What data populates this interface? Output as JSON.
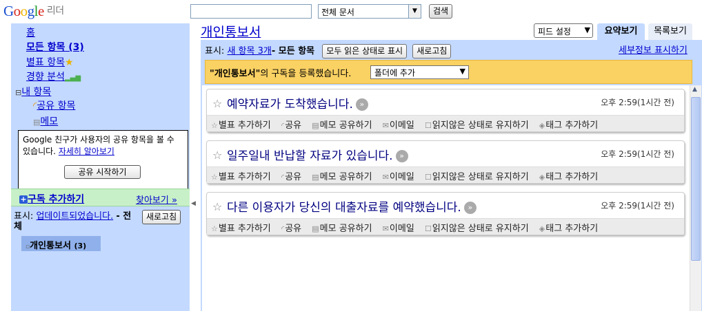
{
  "header": {
    "logo_sub": "리더",
    "search_placeholder": "",
    "scope": "전체 문서",
    "search_button": "검색"
  },
  "sidebar": {
    "home": "홈",
    "all_items": "모든 항목 (3)",
    "starred": "별표 항목",
    "trends": "경향 분석",
    "my_items": "내 항목",
    "shared": "공유 항목",
    "notes": "메모",
    "share_box_text": "Google 친구가 사용자의 공유 항목을 볼 수 있습니다.",
    "share_box_link": "자세히 알아보기",
    "share_start": "공유 시작하기",
    "add_subscription": "구독 추가하기",
    "browse": "찾아보기 »",
    "status_prefix": "표시:",
    "status_link": "업데이트되었습니다.",
    "status_suffix": "- 전체",
    "refresh": "새로고침",
    "feed_name": "개인통보서",
    "feed_count": "(3)"
  },
  "main": {
    "title": "개인통보서",
    "feed_settings": "피드 설정",
    "tab_summary": "요약보기",
    "tab_list": "목록보기",
    "show_prefix": "표시:",
    "new_items": "새 항목 3개",
    "all_items": "- 모든 항목",
    "mark_all_read": "모두 읽은 상태로 표시",
    "refresh": "새로고침",
    "details": "세부정보 표시하기",
    "notice_feed": "\"개인통보서\"",
    "notice_text": "의 구독을 등록했습니다.",
    "folder_select": "폴더에 추가"
  },
  "entries": [
    {
      "title": "예약자료가 도착했습니다.",
      "time": "오후 2:59(1시간 전)"
    },
    {
      "title": "일주일내 반납할 자료가 있습니다.",
      "time": "오후 2:59(1시간 전)"
    },
    {
      "title": "다른 이용자가 당신의 대출자료를 예약했습니다.",
      "time": "오후 2:59(1시간 전)"
    }
  ],
  "entry_actions": {
    "star": "별표 추가하기",
    "share": "공유",
    "share_note": "메모 공유하기",
    "email": "이메일",
    "keep_unread": "읽지않은 상태로 유지하기",
    "tag": "태그 추가하기"
  }
}
